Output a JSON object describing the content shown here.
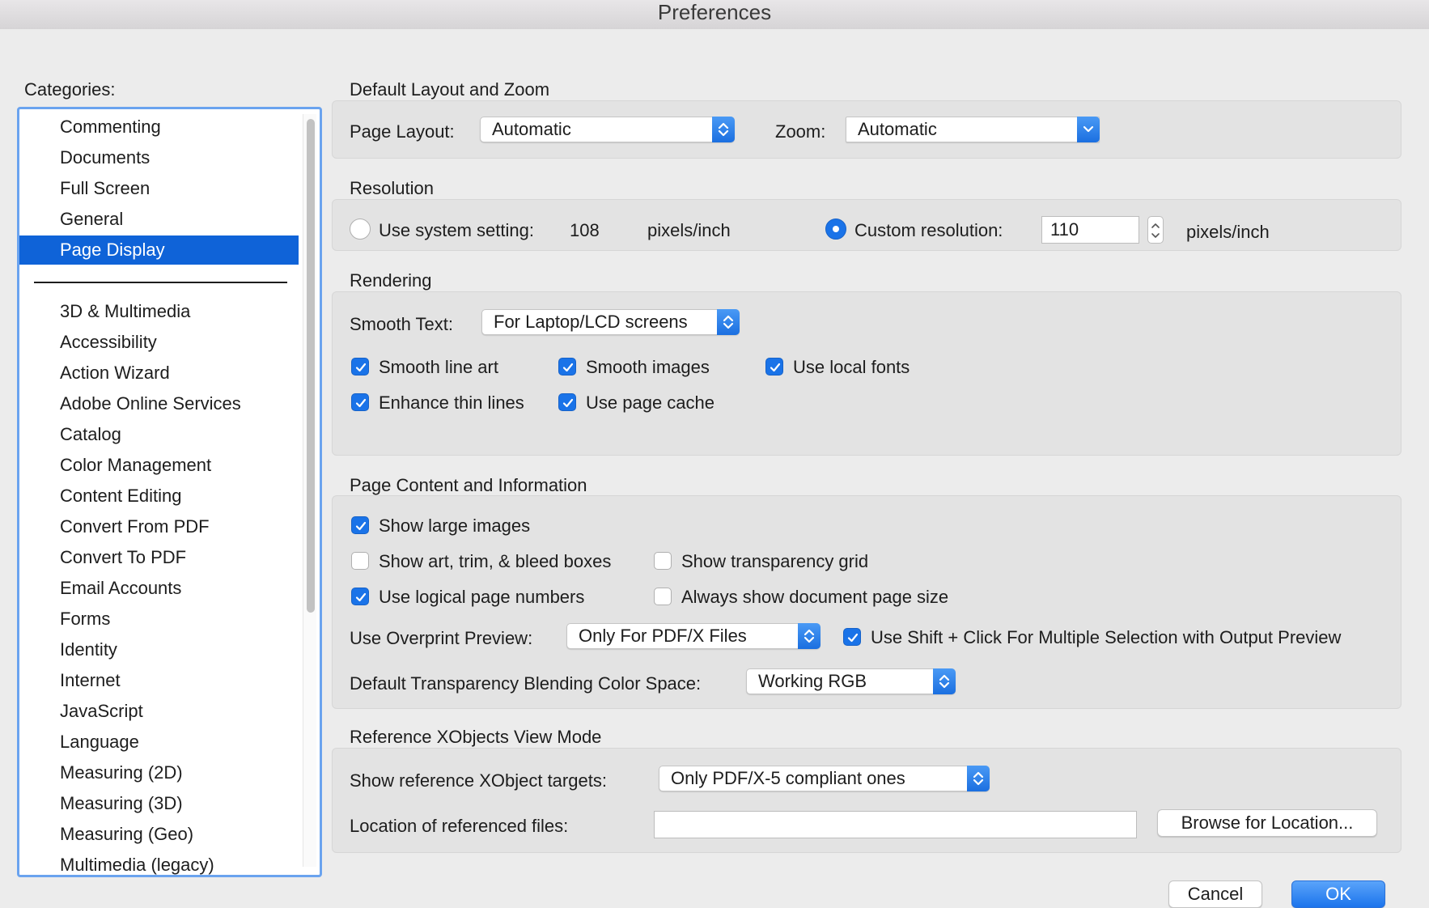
{
  "window": {
    "title": "Preferences"
  },
  "categories": {
    "label": "Categories:",
    "selected": "Page Display",
    "group1": [
      "Commenting",
      "Documents",
      "Full Screen",
      "General",
      "Page Display"
    ],
    "group2": [
      "3D & Multimedia",
      "Accessibility",
      "Action Wizard",
      "Adobe Online Services",
      "Catalog",
      "Color Management",
      "Content Editing",
      "Convert From PDF",
      "Convert To PDF",
      "Email Accounts",
      "Forms",
      "Identity",
      "Internet",
      "JavaScript",
      "Language",
      "Measuring (2D)",
      "Measuring (3D)",
      "Measuring (Geo)",
      "Multimedia (legacy)"
    ]
  },
  "layout_zoom": {
    "title": "Default Layout and Zoom",
    "page_layout_label": "Page Layout:",
    "page_layout_value": "Automatic",
    "zoom_label": "Zoom:",
    "zoom_value": "Automatic"
  },
  "resolution": {
    "title": "Resolution",
    "system_label": "Use system setting:",
    "system_value": "108",
    "system_unit": "pixels/inch",
    "system_selected": false,
    "custom_label": "Custom resolution:",
    "custom_value": "110",
    "custom_unit": "pixels/inch",
    "custom_selected": true
  },
  "rendering": {
    "title": "Rendering",
    "smooth_text_label": "Smooth Text:",
    "smooth_text_value": "For Laptop/LCD screens",
    "smooth_line_art": {
      "label": "Smooth line art",
      "checked": true
    },
    "smooth_images": {
      "label": "Smooth images",
      "checked": true
    },
    "use_local_fonts": {
      "label": "Use local fonts",
      "checked": true
    },
    "enhance_thin_lines": {
      "label": "Enhance thin lines",
      "checked": true
    },
    "use_page_cache": {
      "label": "Use page cache",
      "checked": true
    }
  },
  "page_content": {
    "title": "Page Content and Information",
    "show_large_images": {
      "label": "Show large images",
      "checked": true
    },
    "show_art_trim_bleed": {
      "label": "Show art, trim, & bleed boxes",
      "checked": false
    },
    "show_transparency_grid": {
      "label": "Show transparency grid",
      "checked": false
    },
    "use_logical_page_numbers": {
      "label": "Use logical page numbers",
      "checked": true
    },
    "always_show_page_size": {
      "label": "Always show document page size",
      "checked": false
    },
    "overprint_label": "Use Overprint Preview:",
    "overprint_value": "Only For PDF/X Files",
    "shift_click": {
      "label": "Use Shift + Click For Multiple Selection with Output Preview",
      "checked": true
    },
    "blend_space_label": "Default Transparency Blending Color Space:",
    "blend_space_value": "Working RGB"
  },
  "xobjects": {
    "title": "Reference XObjects View Mode",
    "targets_label": "Show reference XObject targets:",
    "targets_value": "Only PDF/X-5 compliant ones",
    "location_label": "Location of referenced files:",
    "location_value": "",
    "browse_label": "Browse for Location..."
  },
  "footer": {
    "cancel_label": "Cancel",
    "ok_label": "OK"
  },
  "colors": {
    "accent": "#1a73e8",
    "selection": "#0f63d8",
    "list_border": "#6aa3ef"
  }
}
